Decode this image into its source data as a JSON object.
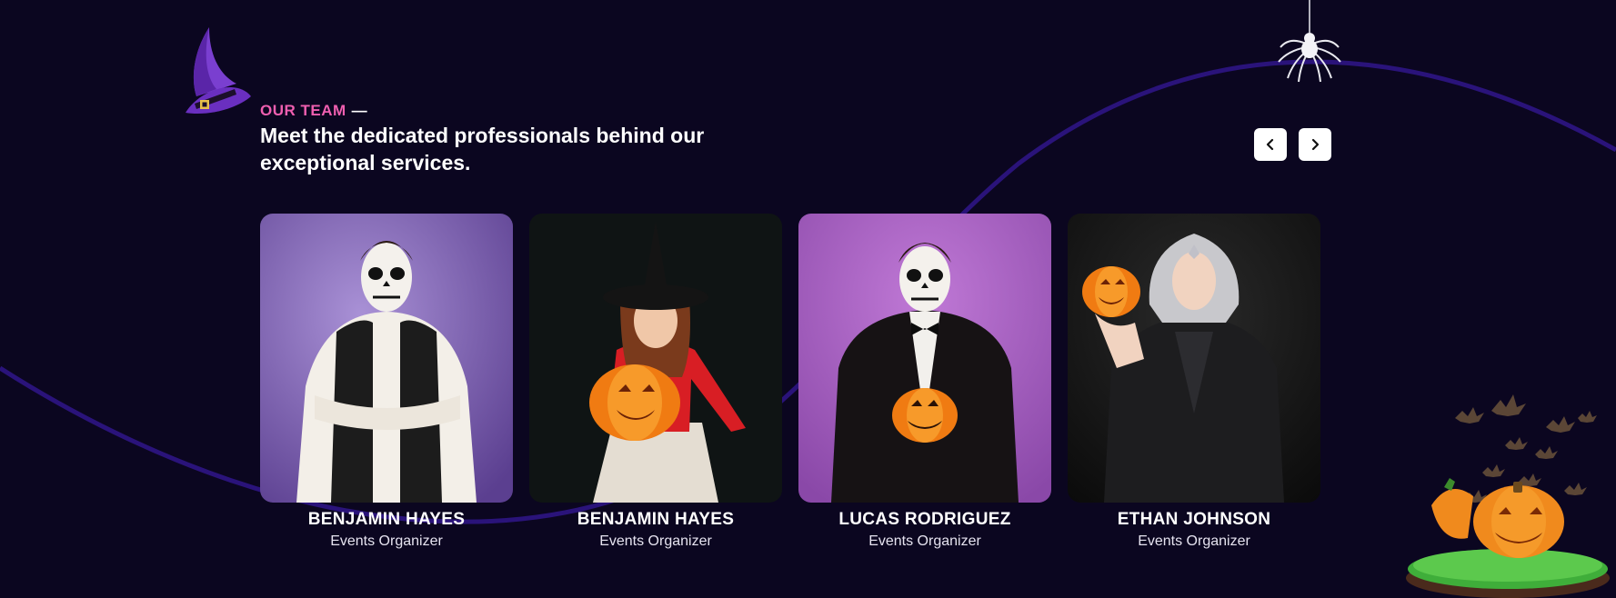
{
  "section": {
    "eyebrow": "OUR TEAM",
    "eyebrow_dash": "—",
    "headline": "Meet the dedicated professionals behind our exceptional services."
  },
  "carousel": {
    "prev_icon": "chevron-left-icon",
    "next_icon": "chevron-right-icon"
  },
  "team": [
    {
      "name": "BENJAMIN HAYES",
      "role": "Events Organizer",
      "bg": "#9a80c9"
    },
    {
      "name": "BENJAMIN HAYES",
      "role": "Events Organizer",
      "bg": "#0f1414"
    },
    {
      "name": "LUCAS RODRIGUEZ",
      "role": "Events Organizer",
      "bg": "#a65fc1"
    },
    {
      "name": "ETHAN JOHNSON",
      "role": "Events Organizer",
      "bg": "#141414"
    }
  ],
  "colors": {
    "background": "#0b0620",
    "accent": "#ef5fb0",
    "wave": "#2a137a"
  }
}
